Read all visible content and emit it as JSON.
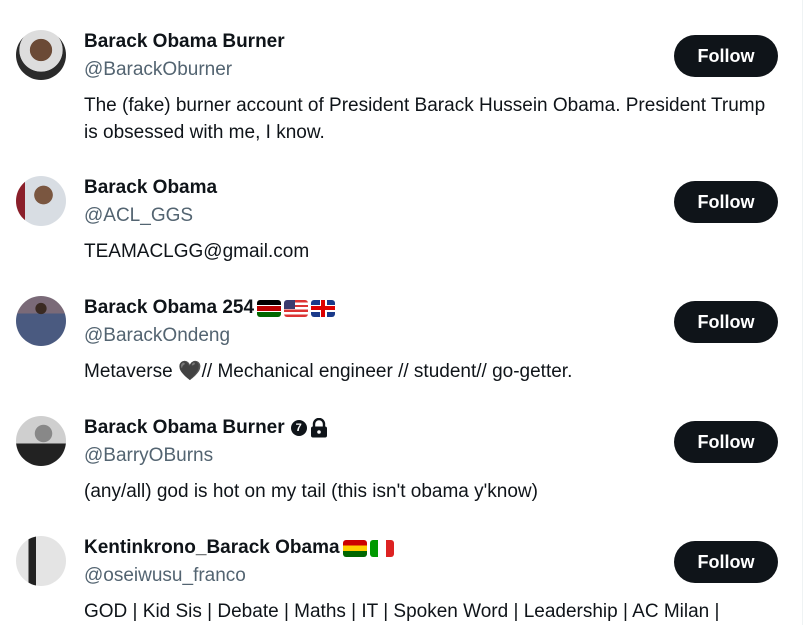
{
  "accent": "#0f1419",
  "follow_label": "Follow",
  "accounts": [
    {
      "name": "Barack Obama Burner",
      "handle": "@BarackOburner",
      "bio": "The (fake) burner account of President Barack Hussein Obama. President Trump is obsessed with me, I know."
    },
    {
      "name": "Barack Obama",
      "handle": "@ACL_GGS",
      "bio": "TEAMACLGG@gmail.com"
    },
    {
      "name": "Barack Obama 254",
      "handle": "@BarackOndeng",
      "bio": "Metaverse 🖤// Mechanical engineer // student// go-getter.",
      "flags": [
        "kenya-flag",
        "usa-flag",
        "uk-flag"
      ]
    },
    {
      "name": "Barack Obama Burner",
      "handle": "@BarryOBurns",
      "bio": "(any/all) god is hot on my tail (this isn't obama y'know)",
      "badge": "7",
      "icons": [
        "number-badge-icon",
        "lock-icon"
      ]
    },
    {
      "name": "Kentinkrono_Barack Obama",
      "handle": "@oseiwusu_franco",
      "bio": "GOD | Kid Sis | Debate | Maths | IT | Spoken Word | Leadership | AC Milan |",
      "flags": [
        "ghana-flag",
        "italy-flag"
      ]
    }
  ]
}
